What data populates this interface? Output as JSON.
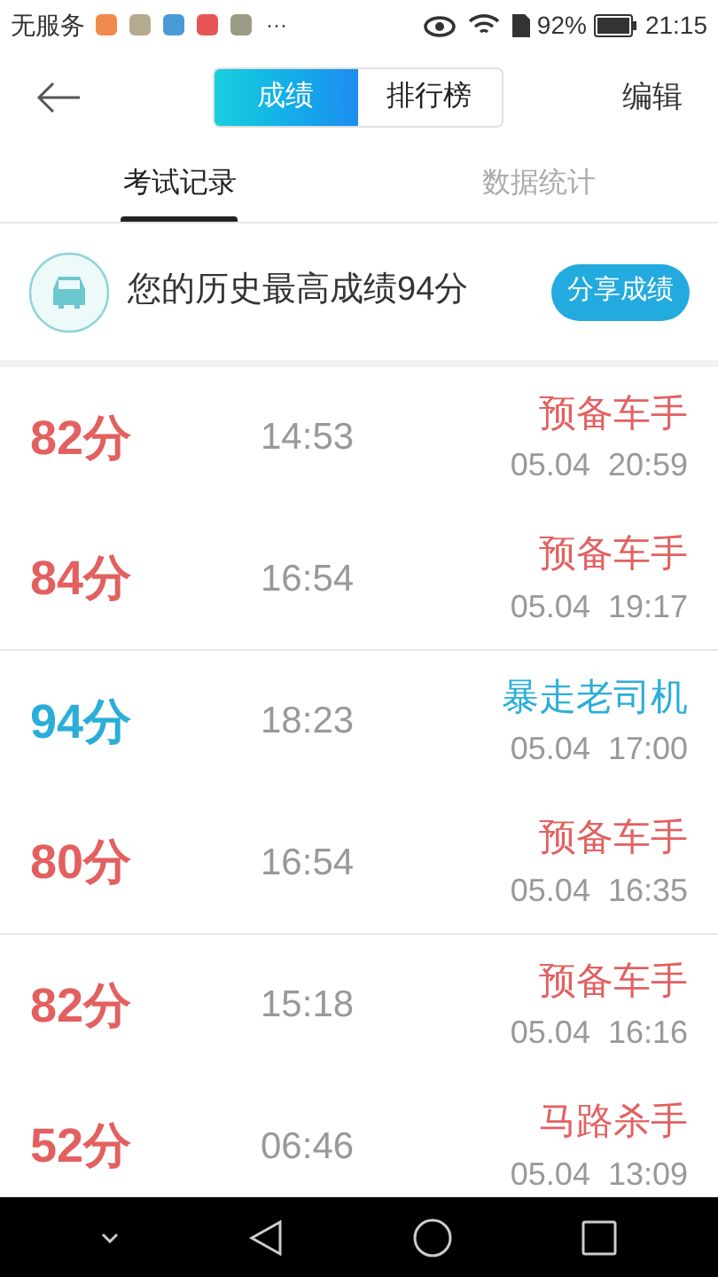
{
  "status_bar": {
    "carrier": "无服务",
    "more": "···",
    "battery": "92%",
    "time": "21:15"
  },
  "header": {
    "segments": [
      {
        "label": "成绩",
        "selected": true
      },
      {
        "label": "排行榜",
        "selected": false
      }
    ],
    "edit": "编辑"
  },
  "tabs": [
    {
      "label": "考试记录",
      "selected": true
    },
    {
      "label": "数据统计",
      "selected": false
    }
  ],
  "banner": {
    "text": "您的历史最高成绩94分",
    "button": "分享成绩"
  },
  "records": [
    {
      "score": "82分",
      "duration": "14:53",
      "title": "预备车手",
      "date": "05.04  20:59",
      "color": "#e36060"
    },
    {
      "score": "84分",
      "duration": "16:54",
      "title": "预备车手",
      "date": "05.04  19:17",
      "color": "#e36060"
    },
    {
      "score": "94分",
      "duration": "18:23",
      "title": "暴走老司机",
      "date": "05.04  17:00",
      "color": "#2aaed8"
    },
    {
      "score": "80分",
      "duration": "16:54",
      "title": "预备车手",
      "date": "05.04  16:35",
      "color": "#e36060"
    },
    {
      "score": "82分",
      "duration": "15:18",
      "title": "预备车手",
      "date": "05.04  16:16",
      "color": "#e36060"
    },
    {
      "score": "52分",
      "duration": "06:46",
      "title": "马路杀手",
      "date": "05.04  13:09",
      "color": "#e36060"
    }
  ]
}
